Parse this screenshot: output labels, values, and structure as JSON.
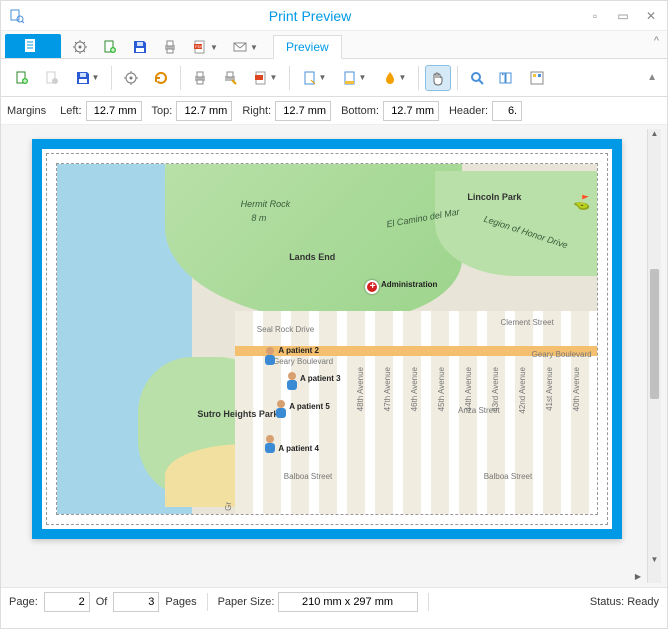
{
  "window": {
    "title": "Print Preview"
  },
  "tabs": {
    "preview": "Preview"
  },
  "margins": {
    "section_label": "Margins",
    "left_label": "Left:",
    "left_value": "12.7 mm",
    "top_label": "Top:",
    "top_value": "12.7 mm",
    "right_label": "Right:",
    "right_value": "12.7 mm",
    "bottom_label": "Bottom:",
    "bottom_value": "12.7 mm",
    "header_label": "Header:",
    "header_value": "6."
  },
  "map": {
    "places": {
      "hermit_rock": "Hermit Rock",
      "hermit_elev": "8 m",
      "lands_end": "Lands End",
      "lincoln_park": "Lincoln Park",
      "sutro_heights": "Sutro Heights Park",
      "legion_drive": "Legion of Honor Drive",
      "el_camino": "El Camino del Mar"
    },
    "streets": {
      "seal_rock": "Seal Rock Drive",
      "geary": "Geary Boulevard",
      "geary2": "Geary Boulevard",
      "clement": "Clement Street",
      "anza": "Anza Street",
      "balboa": "Balboa Street",
      "balboa2": "Balboa Street",
      "av40": "40th Avenue",
      "av41": "41st Avenue",
      "av42": "42nd Avenue",
      "av43": "43rd Avenue",
      "av44": "44th Avenue",
      "av45": "45th Avenue",
      "av46": "46th Avenue",
      "av47": "47th Avenue",
      "av48": "48th Avenue",
      "gr": "Gr"
    },
    "markers": {
      "admin": "Administration",
      "p2": "A patient 2",
      "p3": "A patient 3",
      "p4": "A patient 4",
      "p5": "A patient 5"
    }
  },
  "status": {
    "page_label": "Page:",
    "page_value": "2",
    "of_label": "Of",
    "of_value": "3",
    "pages_label": "Pages",
    "paper_label": "Paper Size:",
    "paper_value": "210 mm x 297 mm",
    "status_label": "Status:",
    "status_value": "Ready"
  }
}
